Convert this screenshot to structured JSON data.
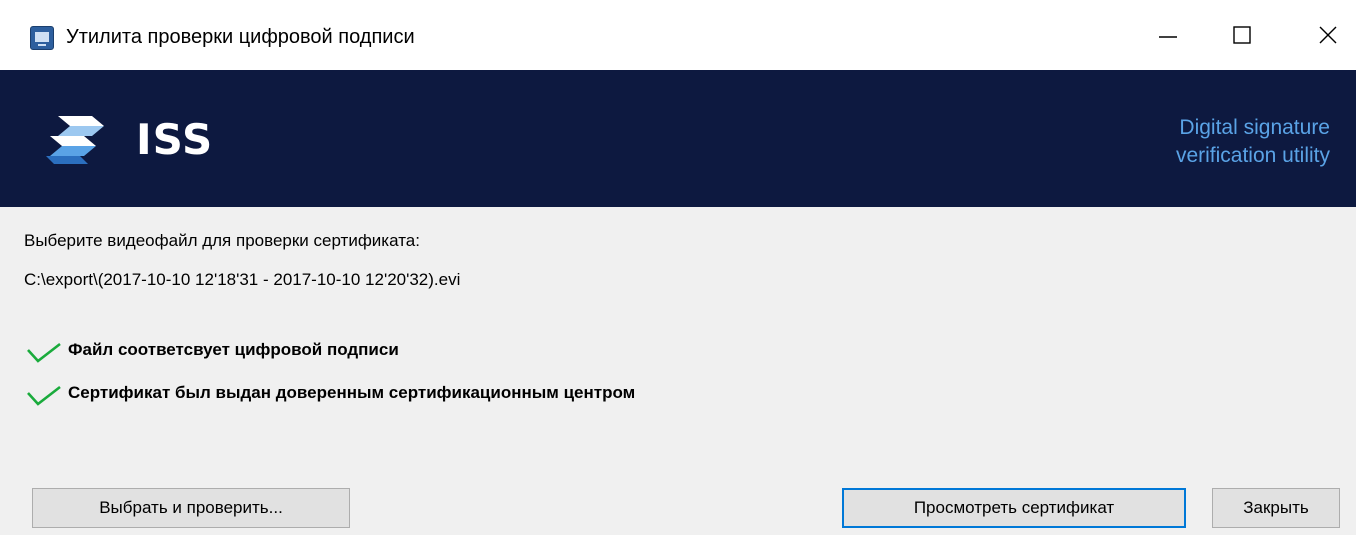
{
  "window": {
    "title": "Утилита проверки цифровой подписи"
  },
  "titlebar_buttons": {
    "minimize_icon": "minimize-icon",
    "maximize_icon": "maximize-icon",
    "close_icon": "close-icon"
  },
  "banner": {
    "logo_text": "ISS",
    "caption_line1": "Digital signature",
    "caption_line2": "verification utility",
    "background_color": "#0d1940",
    "caption_color": "#5aa3e6"
  },
  "content": {
    "choose_label": "Выберите видеофайл для проверки сертификата:",
    "file_path": "C:\\export\\(2017-10-10 12'18'31 - 2017-10-10 12'20'32).evi",
    "status_items": [
      {
        "icon": "checkmark-icon",
        "text": "Файл соответсвует цифровой подписи"
      },
      {
        "icon": "checkmark-icon",
        "text": "Сертификат был выдан доверенным сертификационным центром"
      }
    ],
    "check_color": "#1aab3c"
  },
  "buttons": {
    "select_label": "Выбрать и проверить...",
    "view_label": "Просмотреть сертификат",
    "close_label": "Закрыть",
    "focus_color": "#0078d7"
  }
}
